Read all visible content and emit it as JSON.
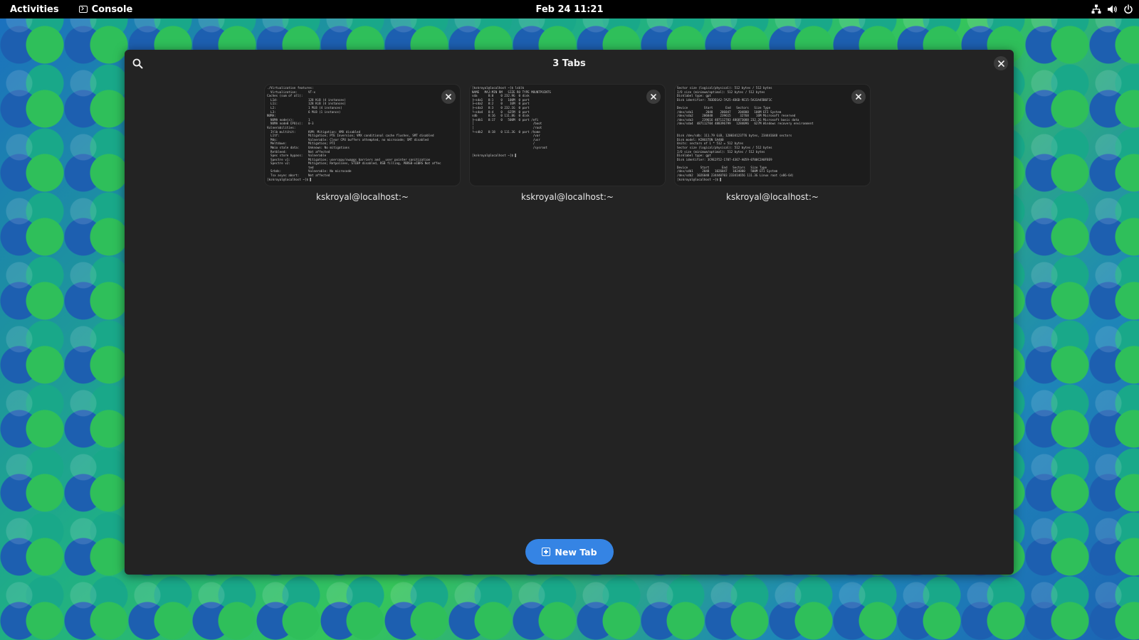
{
  "topbar": {
    "activities": "Activities",
    "app_name": "Console",
    "clock": "Feb 24  11:21",
    "tray_icons": [
      "network-icon",
      "volume-icon",
      "power-icon"
    ]
  },
  "window": {
    "title": "3 Tabs",
    "search_icon": "search-icon",
    "close_icon": "close-icon"
  },
  "tabs": [
    {
      "title": "kskroyal@localhost:~",
      "preview": [
        "./Virtualization features:",
        "  Virtualization:      VT-x",
        "Caches (sum of all):",
        "  L1d:                 128 KiB (4 instances)",
        "  L1i:                 128 KiB (4 instances)",
        "  L2:                  1 MiB (4 instances)",
        "  L3:                  6 MiB (1 instance)",
        "NUMA:",
        "  NUMA node(s):        1",
        "  NUMA node0 CPU(s):   0-3",
        "Vulnerabilities:",
        "  Itlb multihit:       KVM: Mitigation: VMX disabled",
        "  L1tf:                Mitigation; PTE Inversion; VMX conditional cache flushes, SMT disabled",
        "  Mds:                 Vulnerable: Clear CPU buffers attempted, no microcode; SMT disabled",
        "  Meltdown:            Mitigation; PTI",
        "  Mmio stale data:     Unknown: No mitigations",
        "  Retbleed:            Not affected",
        "  Spec store bypass:   Vulnerable",
        "  Spectre v1:          Mitigation; usercopy/swapgs barriers and __user pointer sanitization",
        "  Spectre v2:          Mitigation; Retpolines, STIBP disabled, RSB filling, PBRSB-eIBRS Not affec",
        "                       ted",
        "  Srbds:               Vulnerable: No microcode",
        "  Tsx async abort:     Not affected",
        "[kskroyal@localhost ~]$ ▌"
      ]
    },
    {
      "title": "kskroyal@localhost:~",
      "preview": [
        "[kskroyal@localhost ~]$ lsblk",
        "NAME   MAJ:MIN RM   SIZE RO TYPE MOUNTPOINTS",
        "sda      8:0    0 232.9G  0 disk",
        "├─sda1   8:1    0   100M  0 part",
        "├─sda2   8:2    0    16M  0 part",
        "├─sda3   8:3    0 232.1G  0 part",
        "└─sda4   8:4    0   625M  0 part",
        "sdb      8:16   0 111.8G  0 disk",
        "├─sdb1   8:17   0   500M  0 part /efi",
        "│                                 /boot",
        "│                                 /root",
        "└─sdb2   8:18   0 111.3G  0 part /home",
        "                                  /var",
        "                                  /usr",
        "                                  /",
        "                                  /sysroot",
        "",
        "[kskroyal@localhost ~]$ ▌"
      ]
    },
    {
      "title": "kskroyal@localhost:~",
      "preview": [
        "Sector size (logical/physical): 512 bytes / 512 bytes",
        "I/O size (minimum/optimal): 512 bytes / 512 bytes",
        "Disklabel type: gpt",
        "Disk identifier: 7B3DD1A2-7A25-4D6D-9E15-5A33A45B6F1C",
        "",
        "Device         Start       End   Sectors   Size Type",
        "/dev/sda1       2048    206847    204800   100M EFI System",
        "/dev/sda2     206848    239615     32768    16M Microsoft reserved",
        "/dev/sda3     239616 487112703 486873088 232.2G Microsoft basic data",
        "/dev/sda4  487112704 488396799   1284096   627M Windows recovery environment",
        "",
        "",
        "Disk /dev/sdb: 111.79 GiB, 120034123776 bytes, 234441648 sectors",
        "Disk model: KINGSTON SA400",
        "Units: sectors of 1 * 512 = 512 bytes",
        "Sector size (logical/physical): 512 bytes / 512 bytes",
        "I/O size (minimum/optimal): 512 bytes / 512 bytes",
        "Disklabel type: gpt",
        "Disk identifier: 3C9E2F52-1707-4367-A059-0700C2A0F8E9",
        "",
        "Device       Start       End   Sectors   Size Type",
        "/dev/sdb1     2048   1026047   1024000   500M EFI System",
        "/dev/sdb2  1026048 234440703 233414656 111.3G Linux root (x86-64)",
        "[kskroyal@localhost ~]$ ▌"
      ]
    }
  ],
  "new_tab_label": "New Tab"
}
